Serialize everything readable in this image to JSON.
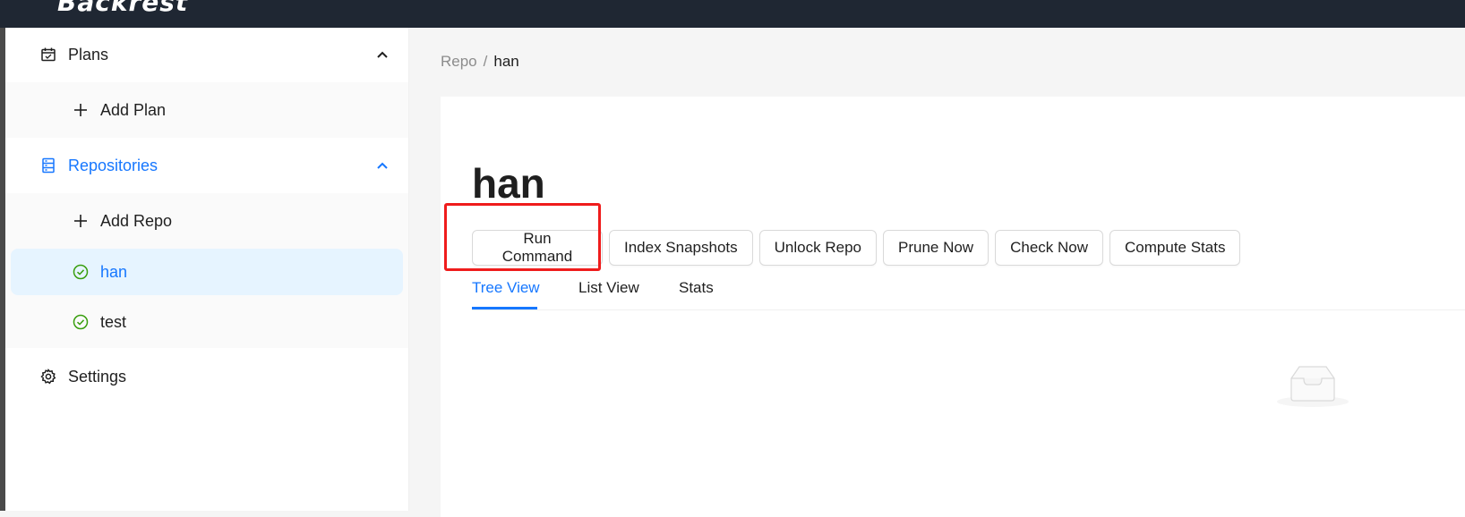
{
  "app": {
    "logo_text": "Backrest"
  },
  "sidebar": {
    "plans": {
      "label": "Plans",
      "icon": "calendar-icon"
    },
    "add_plan": {
      "label": "Add Plan",
      "icon": "plus-icon"
    },
    "repositories": {
      "label": "Repositories",
      "icon": "database-icon"
    },
    "add_repo": {
      "label": "Add Repo",
      "icon": "plus-icon"
    },
    "repos": [
      {
        "label": "han",
        "icon": "check-circle-icon",
        "selected": true
      },
      {
        "label": "test",
        "icon": "check-circle-icon",
        "selected": false
      }
    ],
    "settings": {
      "label": "Settings",
      "icon": "gear-icon"
    }
  },
  "breadcrumb": {
    "parent": "Repo",
    "separator": "/",
    "current": "han"
  },
  "repo": {
    "title": "han"
  },
  "actions": {
    "run_command": "Run Command",
    "index_snapshots": "Index Snapshots",
    "unlock_repo": "Unlock Repo",
    "prune_now": "Prune Now",
    "check_now": "Check Now",
    "compute_stats": "Compute Stats"
  },
  "tabs": {
    "tree_view": "Tree View",
    "list_view": "List View",
    "stats": "Stats",
    "active": "Tree View"
  },
  "colors": {
    "accent": "#1677ff",
    "success": "#389e0d",
    "highlight_box": "#ef1c1c",
    "topbar": "#1f2733"
  }
}
